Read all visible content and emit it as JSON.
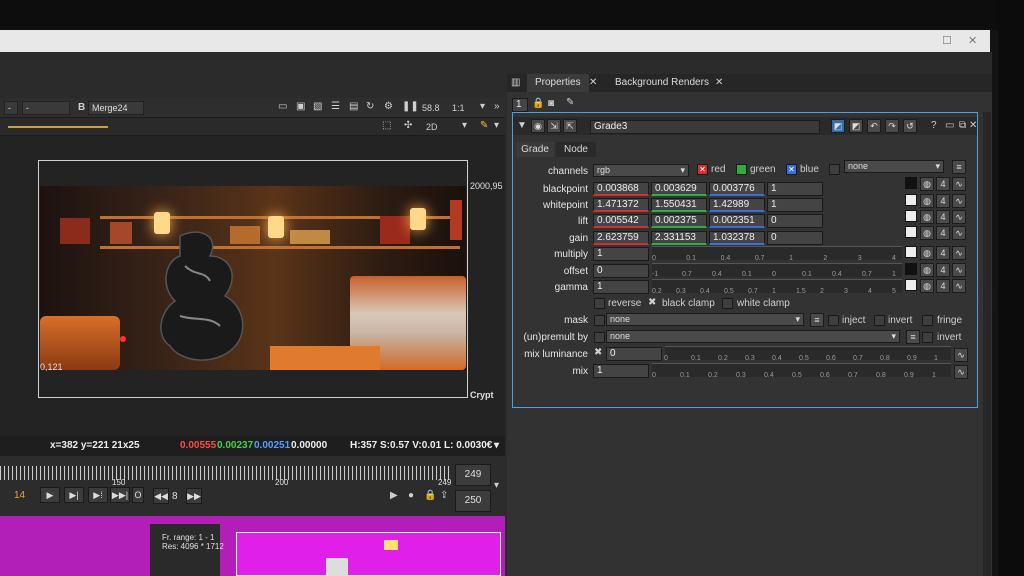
{
  "viewer": {
    "toolbar": {
      "a_select": "-",
      "b_label": "B",
      "b_select": "Merge24",
      "zoom": "58.8",
      "ratio": "1:1",
      "view_mode": "2D"
    },
    "labels": {
      "top_right_coord": "2000,95",
      "bottom_left_coord": "0,121",
      "crypt": "Crypt"
    },
    "info": {
      "coords": "x=382 y=221 21x25",
      "r": "0.00555",
      "g": "0.00237",
      "b": "0.00251",
      "a": "0.00000",
      "hsv": "H:357 S:0.57 V:0.01",
      "l": "L: 0.0030€"
    },
    "timeline": {
      "tick_150": "150",
      "tick_200": "200",
      "tick_249": "249",
      "frame_end": "249",
      "frame_current": "14",
      "step": "8",
      "range_end": "250"
    },
    "nodegraph": {
      "node_info1": "Fr. range: 1 - 1",
      "node_info2": "Res: 4096 * 1712"
    }
  },
  "properties": {
    "tabs": [
      "Properties",
      "Background Renders"
    ],
    "count": "1",
    "node_name": "Grade3",
    "subtabs": [
      "Grade",
      "Node"
    ],
    "channels": {
      "label": "channels",
      "value": "rgb",
      "red": "red",
      "green": "green",
      "blue": "blue",
      "none": "none"
    },
    "rows": [
      {
        "label": "blackpoint",
        "v": [
          "0.003868",
          "0.003629",
          "0.003776",
          "1"
        ]
      },
      {
        "label": "whitepoint",
        "v": [
          "1.471372",
          "1.550431",
          "1.42989",
          "1"
        ]
      },
      {
        "label": "lift",
        "v": [
          "0.005542",
          "0.002375",
          "0.002351",
          "0"
        ]
      },
      {
        "label": "gain",
        "v": [
          "2.623759",
          "2.331153",
          "1.032378",
          "0"
        ]
      }
    ],
    "multiply": {
      "label": "multiply",
      "value": "1"
    },
    "offset": {
      "label": "offset",
      "value": "0"
    },
    "gamma": {
      "label": "gamma",
      "value": "1"
    },
    "checks": {
      "reverse": "reverse",
      "black_clamp": "black clamp",
      "white_clamp": "white clamp"
    },
    "mask": {
      "label": "mask",
      "value": "none",
      "inject": "inject",
      "invert": "invert",
      "fringe": "fringe"
    },
    "unpremult": {
      "label": "(un)premult by",
      "value": "none",
      "invert": "invert"
    },
    "mix_luminance": {
      "label": "mix luminance",
      "value": "0"
    },
    "mix": {
      "label": "mix",
      "value": "1"
    },
    "channel_count": "4",
    "slider_ticks_a": [
      "0",
      "0.1",
      "0.4",
      "0.7",
      "1",
      "2",
      "3",
      "4"
    ],
    "slider_ticks_b": [
      "-1",
      "0.7",
      "0.4",
      "0.1",
      "0",
      "0.1",
      "0.4",
      "0.7",
      "1"
    ],
    "slider_ticks_c": [
      "0.2",
      "0.3",
      "0.4",
      "0.5",
      "0.7",
      "1",
      "1.5",
      "2",
      "3",
      "4",
      "5"
    ],
    "slider_ticks_mix": [
      "0",
      "0.1",
      "0.2",
      "0.3",
      "0.4",
      "0.5",
      "0.6",
      "0.7",
      "0.8",
      "0.9",
      "1"
    ]
  },
  "colors": {
    "red": "#d23030",
    "green": "#2fae3f",
    "blue": "#3a6fd8",
    "accent": "#4aa3e0",
    "nodegraph": "#b21fb8"
  }
}
